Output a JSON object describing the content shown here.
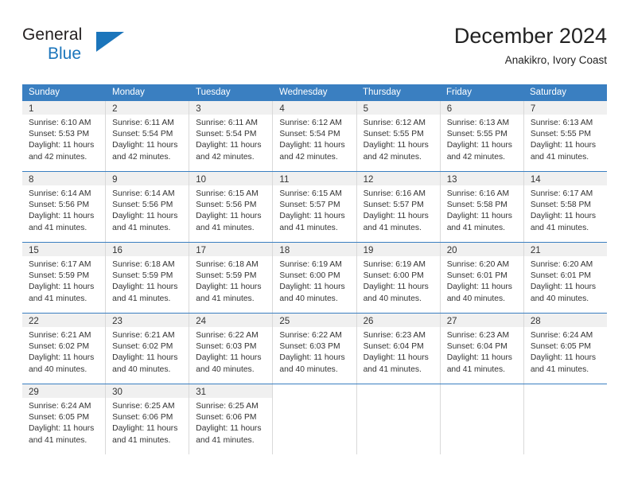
{
  "logo": {
    "word_one": "General",
    "word_two": "Blue",
    "accent_color": "#1b75bb"
  },
  "header": {
    "title": "December 2024",
    "location": "Anakikro, Ivory Coast"
  },
  "calendar": {
    "header_color": "#3a7fc1",
    "weekdays": [
      "Sunday",
      "Monday",
      "Tuesday",
      "Wednesday",
      "Thursday",
      "Friday",
      "Saturday"
    ],
    "weeks": [
      [
        {
          "day": "1",
          "sunrise": "Sunrise: 6:10 AM",
          "sunset": "Sunset: 5:53 PM",
          "daylight_1": "Daylight: 11 hours",
          "daylight_2": "and 42 minutes."
        },
        {
          "day": "2",
          "sunrise": "Sunrise: 6:11 AM",
          "sunset": "Sunset: 5:54 PM",
          "daylight_1": "Daylight: 11 hours",
          "daylight_2": "and 42 minutes."
        },
        {
          "day": "3",
          "sunrise": "Sunrise: 6:11 AM",
          "sunset": "Sunset: 5:54 PM",
          "daylight_1": "Daylight: 11 hours",
          "daylight_2": "and 42 minutes."
        },
        {
          "day": "4",
          "sunrise": "Sunrise: 6:12 AM",
          "sunset": "Sunset: 5:54 PM",
          "daylight_1": "Daylight: 11 hours",
          "daylight_2": "and 42 minutes."
        },
        {
          "day": "5",
          "sunrise": "Sunrise: 6:12 AM",
          "sunset": "Sunset: 5:55 PM",
          "daylight_1": "Daylight: 11 hours",
          "daylight_2": "and 42 minutes."
        },
        {
          "day": "6",
          "sunrise": "Sunrise: 6:13 AM",
          "sunset": "Sunset: 5:55 PM",
          "daylight_1": "Daylight: 11 hours",
          "daylight_2": "and 42 minutes."
        },
        {
          "day": "7",
          "sunrise": "Sunrise: 6:13 AM",
          "sunset": "Sunset: 5:55 PM",
          "daylight_1": "Daylight: 11 hours",
          "daylight_2": "and 41 minutes."
        }
      ],
      [
        {
          "day": "8",
          "sunrise": "Sunrise: 6:14 AM",
          "sunset": "Sunset: 5:56 PM",
          "daylight_1": "Daylight: 11 hours",
          "daylight_2": "and 41 minutes."
        },
        {
          "day": "9",
          "sunrise": "Sunrise: 6:14 AM",
          "sunset": "Sunset: 5:56 PM",
          "daylight_1": "Daylight: 11 hours",
          "daylight_2": "and 41 minutes."
        },
        {
          "day": "10",
          "sunrise": "Sunrise: 6:15 AM",
          "sunset": "Sunset: 5:56 PM",
          "daylight_1": "Daylight: 11 hours",
          "daylight_2": "and 41 minutes."
        },
        {
          "day": "11",
          "sunrise": "Sunrise: 6:15 AM",
          "sunset": "Sunset: 5:57 PM",
          "daylight_1": "Daylight: 11 hours",
          "daylight_2": "and 41 minutes."
        },
        {
          "day": "12",
          "sunrise": "Sunrise: 6:16 AM",
          "sunset": "Sunset: 5:57 PM",
          "daylight_1": "Daylight: 11 hours",
          "daylight_2": "and 41 minutes."
        },
        {
          "day": "13",
          "sunrise": "Sunrise: 6:16 AM",
          "sunset": "Sunset: 5:58 PM",
          "daylight_1": "Daylight: 11 hours",
          "daylight_2": "and 41 minutes."
        },
        {
          "day": "14",
          "sunrise": "Sunrise: 6:17 AM",
          "sunset": "Sunset: 5:58 PM",
          "daylight_1": "Daylight: 11 hours",
          "daylight_2": "and 41 minutes."
        }
      ],
      [
        {
          "day": "15",
          "sunrise": "Sunrise: 6:17 AM",
          "sunset": "Sunset: 5:59 PM",
          "daylight_1": "Daylight: 11 hours",
          "daylight_2": "and 41 minutes."
        },
        {
          "day": "16",
          "sunrise": "Sunrise: 6:18 AM",
          "sunset": "Sunset: 5:59 PM",
          "daylight_1": "Daylight: 11 hours",
          "daylight_2": "and 41 minutes."
        },
        {
          "day": "17",
          "sunrise": "Sunrise: 6:18 AM",
          "sunset": "Sunset: 5:59 PM",
          "daylight_1": "Daylight: 11 hours",
          "daylight_2": "and 41 minutes."
        },
        {
          "day": "18",
          "sunrise": "Sunrise: 6:19 AM",
          "sunset": "Sunset: 6:00 PM",
          "daylight_1": "Daylight: 11 hours",
          "daylight_2": "and 40 minutes."
        },
        {
          "day": "19",
          "sunrise": "Sunrise: 6:19 AM",
          "sunset": "Sunset: 6:00 PM",
          "daylight_1": "Daylight: 11 hours",
          "daylight_2": "and 40 minutes."
        },
        {
          "day": "20",
          "sunrise": "Sunrise: 6:20 AM",
          "sunset": "Sunset: 6:01 PM",
          "daylight_1": "Daylight: 11 hours",
          "daylight_2": "and 40 minutes."
        },
        {
          "day": "21",
          "sunrise": "Sunrise: 6:20 AM",
          "sunset": "Sunset: 6:01 PM",
          "daylight_1": "Daylight: 11 hours",
          "daylight_2": "and 40 minutes."
        }
      ],
      [
        {
          "day": "22",
          "sunrise": "Sunrise: 6:21 AM",
          "sunset": "Sunset: 6:02 PM",
          "daylight_1": "Daylight: 11 hours",
          "daylight_2": "and 40 minutes."
        },
        {
          "day": "23",
          "sunrise": "Sunrise: 6:21 AM",
          "sunset": "Sunset: 6:02 PM",
          "daylight_1": "Daylight: 11 hours",
          "daylight_2": "and 40 minutes."
        },
        {
          "day": "24",
          "sunrise": "Sunrise: 6:22 AM",
          "sunset": "Sunset: 6:03 PM",
          "daylight_1": "Daylight: 11 hours",
          "daylight_2": "and 40 minutes."
        },
        {
          "day": "25",
          "sunrise": "Sunrise: 6:22 AM",
          "sunset": "Sunset: 6:03 PM",
          "daylight_1": "Daylight: 11 hours",
          "daylight_2": "and 40 minutes."
        },
        {
          "day": "26",
          "sunrise": "Sunrise: 6:23 AM",
          "sunset": "Sunset: 6:04 PM",
          "daylight_1": "Daylight: 11 hours",
          "daylight_2": "and 41 minutes."
        },
        {
          "day": "27",
          "sunrise": "Sunrise: 6:23 AM",
          "sunset": "Sunset: 6:04 PM",
          "daylight_1": "Daylight: 11 hours",
          "daylight_2": "and 41 minutes."
        },
        {
          "day": "28",
          "sunrise": "Sunrise: 6:24 AM",
          "sunset": "Sunset: 6:05 PM",
          "daylight_1": "Daylight: 11 hours",
          "daylight_2": "and 41 minutes."
        }
      ],
      [
        {
          "day": "29",
          "sunrise": "Sunrise: 6:24 AM",
          "sunset": "Sunset: 6:05 PM",
          "daylight_1": "Daylight: 11 hours",
          "daylight_2": "and 41 minutes."
        },
        {
          "day": "30",
          "sunrise": "Sunrise: 6:25 AM",
          "sunset": "Sunset: 6:06 PM",
          "daylight_1": "Daylight: 11 hours",
          "daylight_2": "and 41 minutes."
        },
        {
          "day": "31",
          "sunrise": "Sunrise: 6:25 AM",
          "sunset": "Sunset: 6:06 PM",
          "daylight_1": "Daylight: 11 hours",
          "daylight_2": "and 41 minutes."
        },
        {
          "day": "",
          "sunrise": "",
          "sunset": "",
          "daylight_1": "",
          "daylight_2": ""
        },
        {
          "day": "",
          "sunrise": "",
          "sunset": "",
          "daylight_1": "",
          "daylight_2": ""
        },
        {
          "day": "",
          "sunrise": "",
          "sunset": "",
          "daylight_1": "",
          "daylight_2": ""
        },
        {
          "day": "",
          "sunrise": "",
          "sunset": "",
          "daylight_1": "",
          "daylight_2": ""
        }
      ]
    ]
  }
}
